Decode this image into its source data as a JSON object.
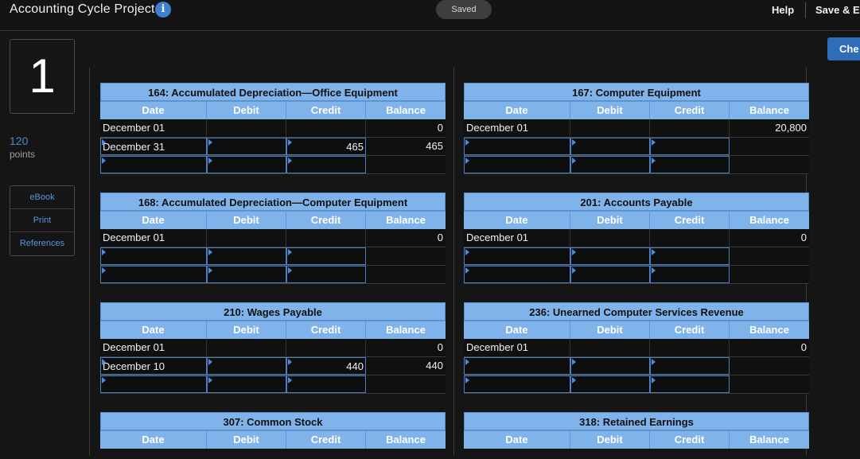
{
  "header": {
    "app_title": "Accounting Cycle Project",
    "info_icon": "info-icon",
    "saved_label": "Saved",
    "help_label": "Help",
    "save_exit_label": "Save & E"
  },
  "question": {
    "number": "1",
    "points_value": "120",
    "points_label": "points"
  },
  "resources": [
    {
      "label": "eBook"
    },
    {
      "label": "Print"
    },
    {
      "label": "References"
    }
  ],
  "check_button_label": "Che",
  "colors": {
    "header_bg": "#80b3ea",
    "accent": "#3d7fd1",
    "link": "#5b95dc"
  },
  "ledgers": [
    {
      "title": "164: Accumulated Depreciation—Office Equipment",
      "columns": [
        "Date",
        "Debit",
        "Credit",
        "Balance"
      ],
      "rows": [
        {
          "date": "December 01",
          "debit": "",
          "credit": "",
          "balance": "0",
          "editable": false
        },
        {
          "date": "December 31",
          "debit": "",
          "credit": "465",
          "balance": "465",
          "editable": true
        },
        {
          "date": "",
          "debit": "",
          "credit": "",
          "balance": "",
          "editable": true
        }
      ]
    },
    {
      "title": "167: Computer Equipment",
      "columns": [
        "Date",
        "Debit",
        "Credit",
        "Balance"
      ],
      "rows": [
        {
          "date": "December 01",
          "debit": "",
          "credit": "",
          "balance": "20,800",
          "editable": false
        },
        {
          "date": "",
          "debit": "",
          "credit": "",
          "balance": "",
          "editable": true
        },
        {
          "date": "",
          "debit": "",
          "credit": "",
          "balance": "",
          "editable": true
        }
      ]
    },
    {
      "title": "168: Accumulated Depreciation—Computer Equipment",
      "columns": [
        "Date",
        "Debit",
        "Credit",
        "Balance"
      ],
      "rows": [
        {
          "date": "December 01",
          "debit": "",
          "credit": "",
          "balance": "0",
          "editable": false
        },
        {
          "date": "",
          "debit": "",
          "credit": "",
          "balance": "",
          "editable": true
        },
        {
          "date": "",
          "debit": "",
          "credit": "",
          "balance": "",
          "editable": true
        }
      ]
    },
    {
      "title": "201: Accounts Payable",
      "columns": [
        "Date",
        "Debit",
        "Credit",
        "Balance"
      ],
      "rows": [
        {
          "date": "December 01",
          "debit": "",
          "credit": "",
          "balance": "0",
          "editable": false
        },
        {
          "date": "",
          "debit": "",
          "credit": "",
          "balance": "",
          "editable": true
        },
        {
          "date": "",
          "debit": "",
          "credit": "",
          "balance": "",
          "editable": true
        }
      ]
    },
    {
      "title": "210: Wages Payable",
      "columns": [
        "Date",
        "Debit",
        "Credit",
        "Balance"
      ],
      "rows": [
        {
          "date": "December 01",
          "debit": "",
          "credit": "",
          "balance": "0",
          "editable": false
        },
        {
          "date": "December 10",
          "debit": "",
          "credit": "440",
          "balance": "440",
          "editable": true
        },
        {
          "date": "",
          "debit": "",
          "credit": "",
          "balance": "",
          "editable": true
        }
      ]
    },
    {
      "title": "236: Unearned Computer Services Revenue",
      "columns": [
        "Date",
        "Debit",
        "Credit",
        "Balance"
      ],
      "rows": [
        {
          "date": "December 01",
          "debit": "",
          "credit": "",
          "balance": "0",
          "editable": false
        },
        {
          "date": "",
          "debit": "",
          "credit": "",
          "balance": "",
          "editable": true
        },
        {
          "date": "",
          "debit": "",
          "credit": "",
          "balance": "",
          "editable": true
        }
      ]
    },
    {
      "title": "307: Common Stock",
      "columns": [
        "Date",
        "Debit",
        "Credit",
        "Balance"
      ],
      "rows": []
    },
    {
      "title": "318: Retained Earnings",
      "columns": [
        "Date",
        "Debit",
        "Credit",
        "Balance"
      ],
      "rows": []
    }
  ]
}
